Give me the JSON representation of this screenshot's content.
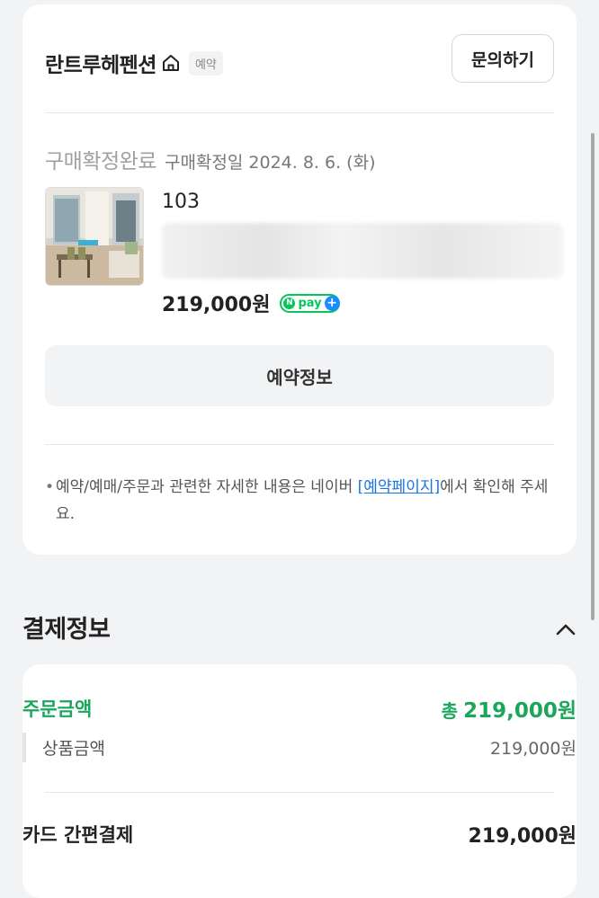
{
  "order": {
    "store_name": "란트루헤펜션",
    "badge": "예약",
    "inquiry_label": "문의하기",
    "status": "구매확정완료",
    "confirm_date": "구매확정일 2024. 8. 6. (화)",
    "room_name": "103",
    "price": "219,000원",
    "npay": {
      "n": "N",
      "text": "pay",
      "plus": "+"
    },
    "reservation_info_label": "예약정보",
    "notice": {
      "bullet": "•",
      "before": "예약/예매/주문과 관련한 자세한 내용은 네이버 ",
      "link": "[예약페이지]",
      "after": "에서 확인해 주세요."
    }
  },
  "payment": {
    "title": "결제정보",
    "order_amount_label": "주문금액",
    "order_total_prefix": "총",
    "order_total_value": "219,000원",
    "product_amount_label": "상품금액",
    "product_amount_value": "219,000원",
    "card_pay_label": "카드 간편결제",
    "card_pay_value": "219,000원"
  },
  "colors": {
    "accent_green": "#1aa65b",
    "npay_green": "#03c75a",
    "link_blue": "#1a73e8",
    "background": "#f2f3f5"
  },
  "icons": [
    "home-icon",
    "chevron-up-icon"
  ]
}
